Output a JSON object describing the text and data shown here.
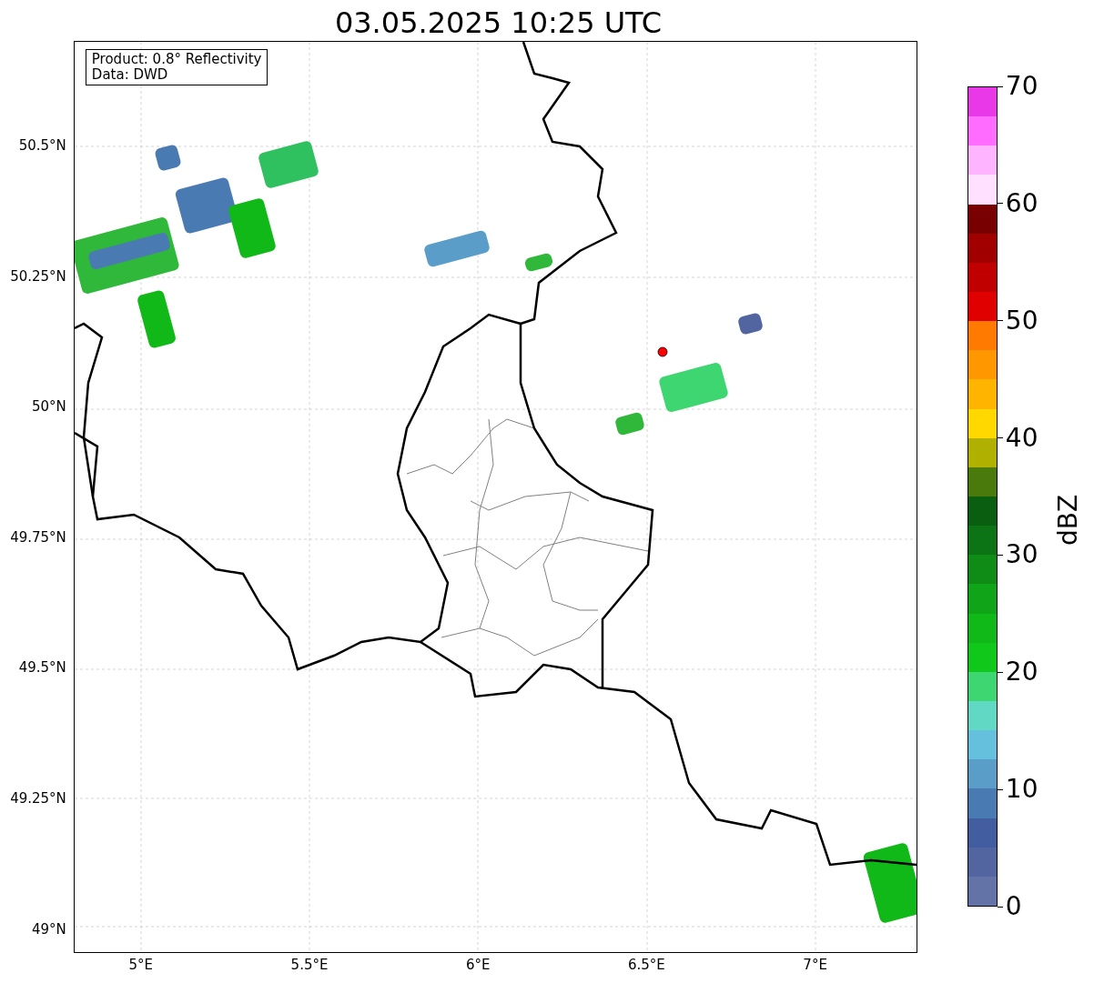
{
  "title": "03.05.2025 10:25 UTC",
  "info_box": {
    "lines": [
      "Product: 0.8° Reflectivity",
      "Data: DWD"
    ]
  },
  "lat_ticks": [
    "50.5°N",
    "50.25°N",
    "50°N",
    "49.75°N",
    "49.5°N",
    "49.25°N",
    "49°N"
  ],
  "lon_ticks": [
    "5°E",
    "5.5°E",
    "6°E",
    "6.5°E",
    "7°E"
  ],
  "colorbar": {
    "label": "dBZ",
    "ticks": [
      "70",
      "60",
      "50",
      "40",
      "30",
      "20",
      "10",
      "0"
    ],
    "segments": [
      {
        "color": "#e838e8"
      },
      {
        "color": "#ff6cff"
      },
      {
        "color": "#ffb4ff"
      },
      {
        "color": "#ffe0ff"
      },
      {
        "color": "#780000"
      },
      {
        "color": "#a00000"
      },
      {
        "color": "#c00000"
      },
      {
        "color": "#e00000"
      },
      {
        "color": "#ff7a00"
      },
      {
        "color": "#ff9800"
      },
      {
        "color": "#ffb400"
      },
      {
        "color": "#ffd800"
      },
      {
        "color": "#b0b000"
      },
      {
        "color": "#4a7a0c"
      },
      {
        "color": "#0a5e10"
      },
      {
        "color": "#0c7414"
      },
      {
        "color": "#0e8c16"
      },
      {
        "color": "#10a418"
      },
      {
        "color": "#10b818"
      },
      {
        "color": "#10c81a"
      },
      {
        "color": "#3ed670"
      },
      {
        "color": "#60d8c4"
      },
      {
        "color": "#64c0dc"
      },
      {
        "color": "#5a9dc8"
      },
      {
        "color": "#4a7ab2"
      },
      {
        "color": "#425da0"
      },
      {
        "color": "#5265a0"
      },
      {
        "color": "#6373a8"
      }
    ]
  }
}
